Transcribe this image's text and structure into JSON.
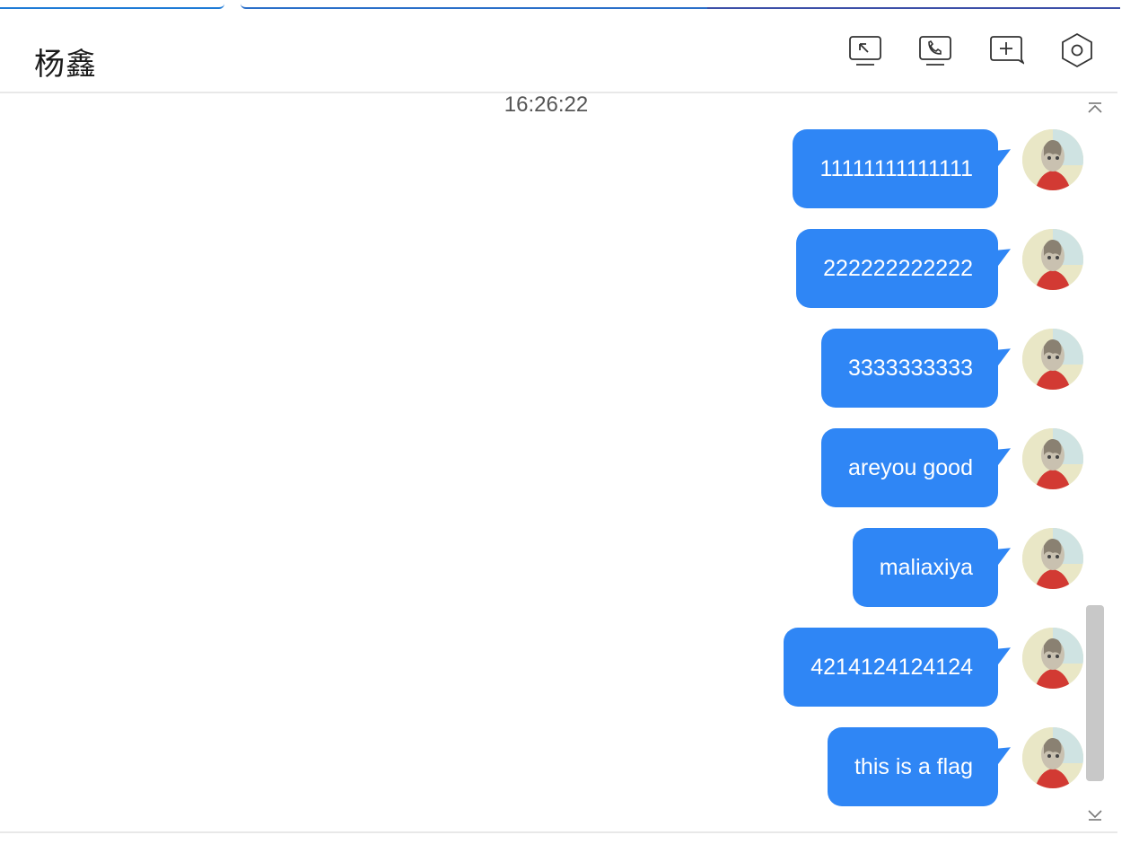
{
  "header": {
    "title": "杨鑫",
    "icons": [
      "screen-share-icon",
      "phone-icon",
      "add-member-icon",
      "settings-icon"
    ]
  },
  "chat": {
    "timestamp": "16:26:22",
    "messages": [
      {
        "text": "11111111111111"
      },
      {
        "text": "222222222222"
      },
      {
        "text": "3333333333"
      },
      {
        "text": "areyou good"
      },
      {
        "text": "maliaxiya"
      },
      {
        "text": "4214124124124"
      },
      {
        "text": "this is a flag"
      }
    ]
  },
  "scrollbar": {
    "up_glyph": "⌅",
    "down_glyph": "⌄"
  },
  "colors": {
    "bubble": "#2f86f5",
    "accent_bar": "#1e7bd6"
  }
}
